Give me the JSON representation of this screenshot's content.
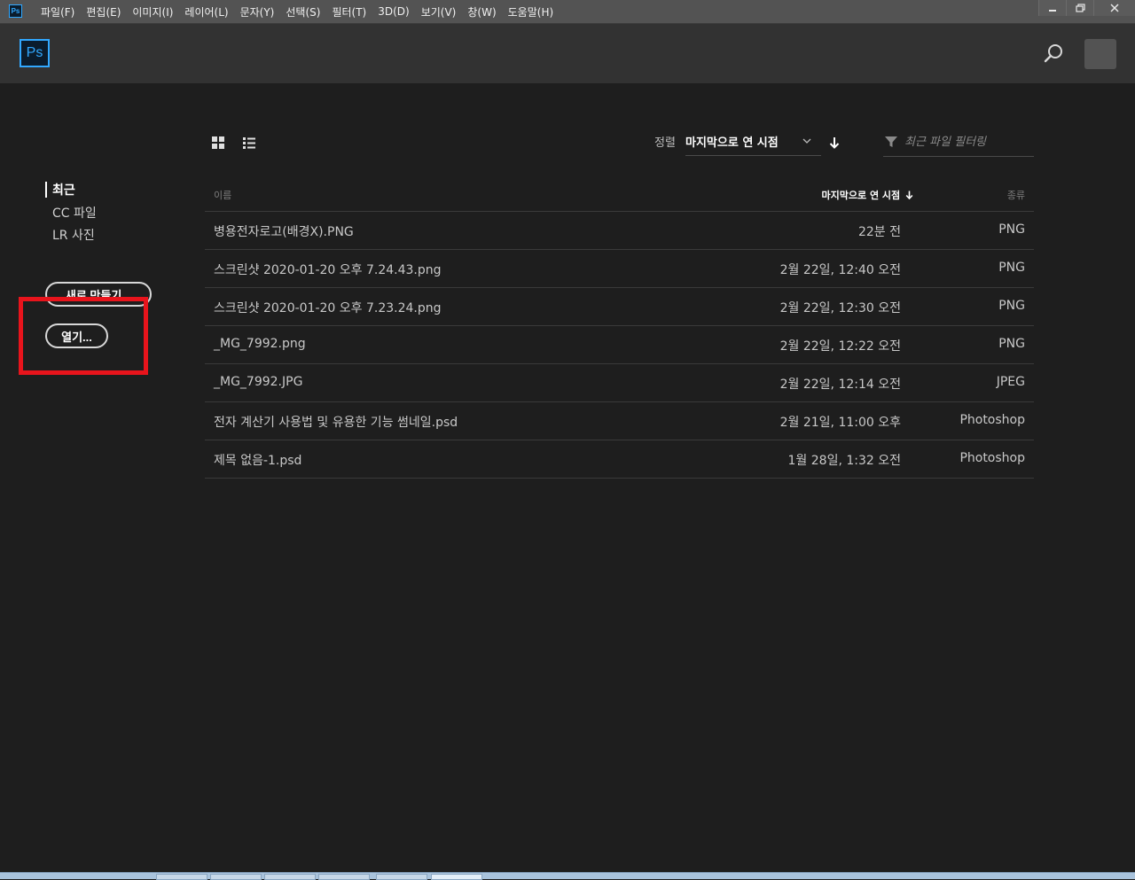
{
  "app": {
    "icon_label": "Ps",
    "logo_label": "Ps",
    "accent_color": "#31a8ff"
  },
  "menubar": {
    "items": [
      "파일(F)",
      "편집(E)",
      "이미지(I)",
      "레이어(L)",
      "문자(Y)",
      "선택(S)",
      "필터(T)",
      "3D(D)",
      "보기(V)",
      "창(W)",
      "도움말(H)"
    ],
    "window_controls": [
      "minimize-icon",
      "restore-icon",
      "close-icon"
    ]
  },
  "header": {
    "search_icon": "search-icon",
    "avatar_icon": "avatar"
  },
  "sidebar": {
    "items": [
      {
        "label": "최근",
        "active": true
      },
      {
        "label": "CC 파일",
        "active": false
      },
      {
        "label": "LR 사진",
        "active": false
      }
    ],
    "new_button": "새로 만들기...",
    "open_button": "열기..."
  },
  "toolbar": {
    "view_icons": [
      "grid-view-icon",
      "list-view-icon"
    ],
    "sort_label": "정렬",
    "sort_value": "마지막으로 연 시점",
    "sort_direction_icon": "arrow-down-icon",
    "filter_placeholder": "최근 파일 필터링",
    "filter_icon": "filter-icon"
  },
  "table": {
    "headers": {
      "name": "이름",
      "date": "마지막으로 연 시점",
      "type": "종류"
    },
    "rows": [
      {
        "name": "병용전자로고(배경X).PNG",
        "date": "22분 전",
        "type": "PNG"
      },
      {
        "name": "스크린샷 2020-01-20 오후 7.24.43.png",
        "date": "2월 22일, 12:40 오전",
        "type": "PNG"
      },
      {
        "name": "스크린샷 2020-01-20 오후 7.23.24.png",
        "date": "2월 22일, 12:30 오전",
        "type": "PNG"
      },
      {
        "name": "_MG_7992.png",
        "date": "2월 22일, 12:22 오전",
        "type": "PNG"
      },
      {
        "name": "_MG_7992.JPG",
        "date": "2월 22일, 12:14 오전",
        "type": "JPEG"
      },
      {
        "name": "전자 계산기 사용법 및 유용한 기능 썸네일.psd",
        "date": "2월 21일, 11:00 오후",
        "type": "Photoshop"
      },
      {
        "name": "제목 없음-1.psd",
        "date": "1월 28일, 1:32 오전",
        "type": "Photoshop"
      }
    ]
  },
  "annotation": {
    "highlight_color": "#e8141c"
  }
}
